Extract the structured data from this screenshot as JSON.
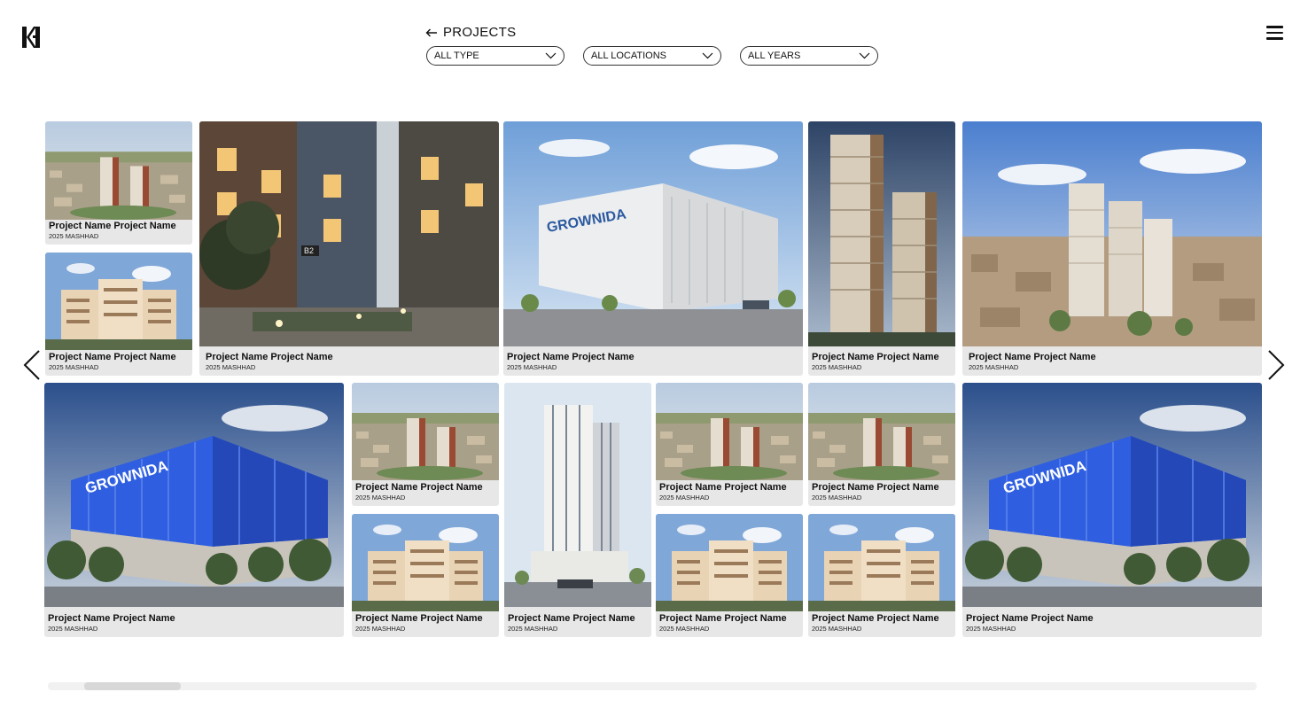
{
  "header": {
    "back_label": "PROJECTS",
    "filters": [
      {
        "name": "type-filter",
        "value": "ALL TYPE"
      },
      {
        "name": "location-filter",
        "value": "ALL LOCATIONS"
      },
      {
        "name": "year-filter",
        "value": "ALL YEARS"
      }
    ],
    "icons": {
      "logo": "brand-logo",
      "menu": "hamburger-menu-icon",
      "back": "arrow-left-icon",
      "dropdown": "chevron-down-icon"
    }
  },
  "nav": {
    "prev": "chevron-left-icon",
    "next": "chevron-right-icon"
  },
  "projects": [
    {
      "name": "Project Name Project Name",
      "meta": "2025 MASHHAD",
      "image": "aerial-towers"
    },
    {
      "name": "Project Name Project Name",
      "meta": "2025 MASHHAD",
      "image": "beige-building"
    },
    {
      "name": "Project Name Project Name",
      "meta": "2025 MASHHAD",
      "image": "night-brick-building"
    },
    {
      "name": "Project Name Project Name",
      "meta": "2025 MASHHAD",
      "image": "white-grownida"
    },
    {
      "name": "Project Name Project Name",
      "meta": "2025 MASHHAD",
      "image": "tall-towers"
    },
    {
      "name": "Project Name Project Name",
      "meta": "2025 MASHHAD",
      "image": "city-towers"
    },
    {
      "name": "Project Name Project Name",
      "meta": "2025 MASHHAD",
      "image": "blue-grownida"
    },
    {
      "name": "Project Name Project Name",
      "meta": "2025 MASHHAD",
      "image": "aerial-towers"
    },
    {
      "name": "Project Name Project Name",
      "meta": "2025 MASHHAD",
      "image": "beige-building"
    },
    {
      "name": "Project Name Project Name",
      "meta": "2025 MASHHAD",
      "image": "white-highrise"
    },
    {
      "name": "Project Name Project Name",
      "meta": "2025 MASHHAD",
      "image": "aerial-towers"
    },
    {
      "name": "Project Name Project Name",
      "meta": "2025 MASHHAD",
      "image": "beige-building"
    },
    {
      "name": "Project Name Project Name",
      "meta": "2025 MASHHAD",
      "image": "aerial-towers"
    },
    {
      "name": "Project Name Project Name",
      "meta": "2025 MASHHAD",
      "image": "beige-building"
    },
    {
      "name": "Project Name Project Name",
      "meta": "2025 MASHHAD",
      "image": "blue-grownida"
    }
  ],
  "image_text": {
    "grownida": "GROWNIDA",
    "block": "B2"
  },
  "scrollbar": {
    "position_fraction": 0.03,
    "visible_fraction": 0.08
  },
  "colors": {
    "card_bg": "#e7e7e7",
    "accent_blue": "#2f5fe0",
    "text": "#111111"
  }
}
